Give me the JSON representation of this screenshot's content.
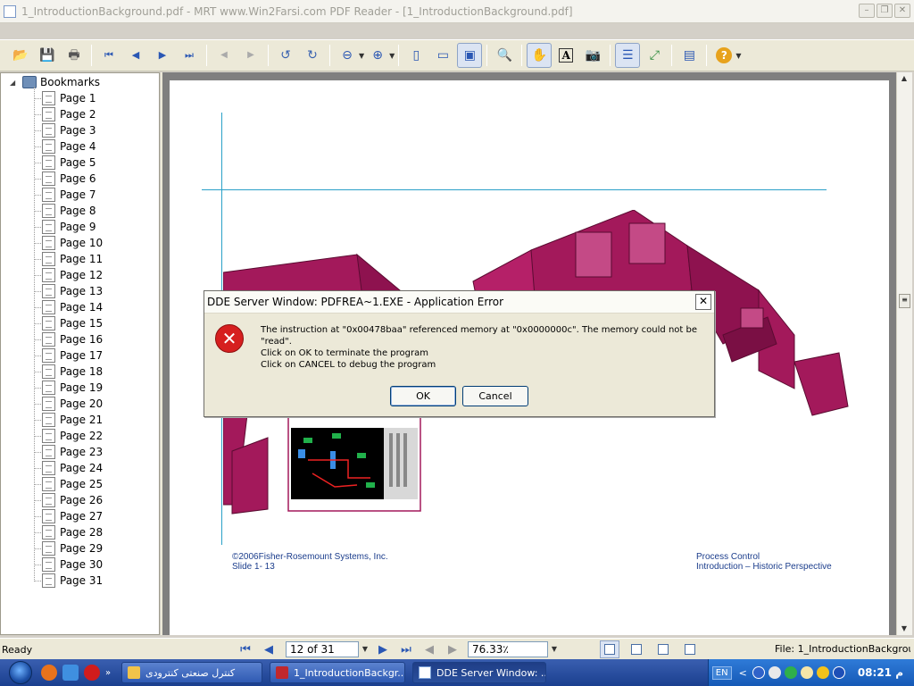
{
  "window": {
    "title": "1_IntroductionBackground.pdf - MRT www.Win2Farsi.com PDF Reader - [1_IntroductionBackground.pdf]",
    "minimize_symbol": "–",
    "restore_symbol": "❐",
    "close_symbol": "✕"
  },
  "toolbar": {
    "buttons": [
      {
        "name": "open-icon",
        "glyph": "📂"
      },
      {
        "name": "save-icon",
        "glyph": "💾"
      },
      {
        "name": "print-icon",
        "glyph": "🖶"
      },
      {
        "name": "first-page-icon",
        "glyph": "⏮"
      },
      {
        "name": "prev-page-icon",
        "glyph": "◀"
      },
      {
        "name": "next-page-icon",
        "glyph": "▶"
      },
      {
        "name": "last-page-icon",
        "glyph": "⏭"
      },
      {
        "name": "back-icon",
        "glyph": "◀"
      },
      {
        "name": "forward-icon",
        "glyph": "▶"
      },
      {
        "name": "rotate-left-icon",
        "glyph": "↺"
      },
      {
        "name": "rotate-right-icon",
        "glyph": "↻"
      },
      {
        "name": "zoom-out-icon",
        "glyph": "⊖"
      },
      {
        "name": "zoom-in-icon",
        "glyph": "⊕"
      },
      {
        "name": "actual-size-icon",
        "glyph": "▯"
      },
      {
        "name": "fit-width-icon",
        "glyph": "▭"
      },
      {
        "name": "fit-page-icon",
        "glyph": "▣"
      },
      {
        "name": "find-icon",
        "glyph": "🔍"
      },
      {
        "name": "hand-tool-icon",
        "glyph": "✋"
      },
      {
        "name": "text-select-icon",
        "glyph": "A"
      },
      {
        "name": "snapshot-icon",
        "glyph": "📷"
      },
      {
        "name": "bookmarks-panel-icon",
        "glyph": "☰"
      },
      {
        "name": "full-screen-icon",
        "glyph": "⤢"
      },
      {
        "name": "properties-icon",
        "glyph": "▤"
      },
      {
        "name": "help-icon",
        "glyph": "?"
      }
    ]
  },
  "bookmarks": {
    "root_label": "Bookmarks",
    "items": [
      "Page 1",
      "Page 2",
      "Page 3",
      "Page 4",
      "Page 5",
      "Page 6",
      "Page 7",
      "Page 8",
      "Page 9",
      "Page 10",
      "Page 11",
      "Page 12",
      "Page 13",
      "Page 14",
      "Page 15",
      "Page 16",
      "Page 17",
      "Page 18",
      "Page 19",
      "Page 20",
      "Page 21",
      "Page 22",
      "Page 23",
      "Page 24",
      "Page 25",
      "Page 26",
      "Page 27",
      "Page 28",
      "Page 29",
      "Page 30",
      "Page 31"
    ]
  },
  "document": {
    "footer_left_1": "©2006Fisher-Rosemount Systems, Inc.",
    "footer_left_2": "Slide 1- 13",
    "footer_right_1": "Process Control",
    "footer_right_2": "Introduction – Historic Perspective",
    "control_room_color": "#a3195b"
  },
  "dialog": {
    "title": "DDE Server Window: PDFREA~1.EXE - Application Error",
    "message": "The instruction at \"0x00478baa\" referenced memory at \"0x0000000c\". The memory could not be \"read\".",
    "line2": "Click on OK to terminate the program",
    "line3": "Click on CANCEL to debug the program",
    "ok_label": "OK",
    "cancel_label": "Cancel",
    "close_symbol": "✕",
    "error_glyph": "✕"
  },
  "statusbar": {
    "status": "Ready",
    "page_field": "12 of 31",
    "zoom_field": "76.33٪",
    "file_label": "File: 1_IntroductionBackgrou"
  },
  "taskbar": {
    "tasks": [
      {
        "label": "کنترل صنعتی کنترودی",
        "icon": "folder-icon"
      },
      {
        "label": "1_IntroductionBackgr...",
        "icon": "pdf-reader-icon"
      },
      {
        "label": "DDE Server Window: ...",
        "icon": "window-icon"
      }
    ],
    "language": "EN",
    "clock": "08:21 م",
    "quick_launch_more": "»",
    "tray_chevron": "<"
  }
}
